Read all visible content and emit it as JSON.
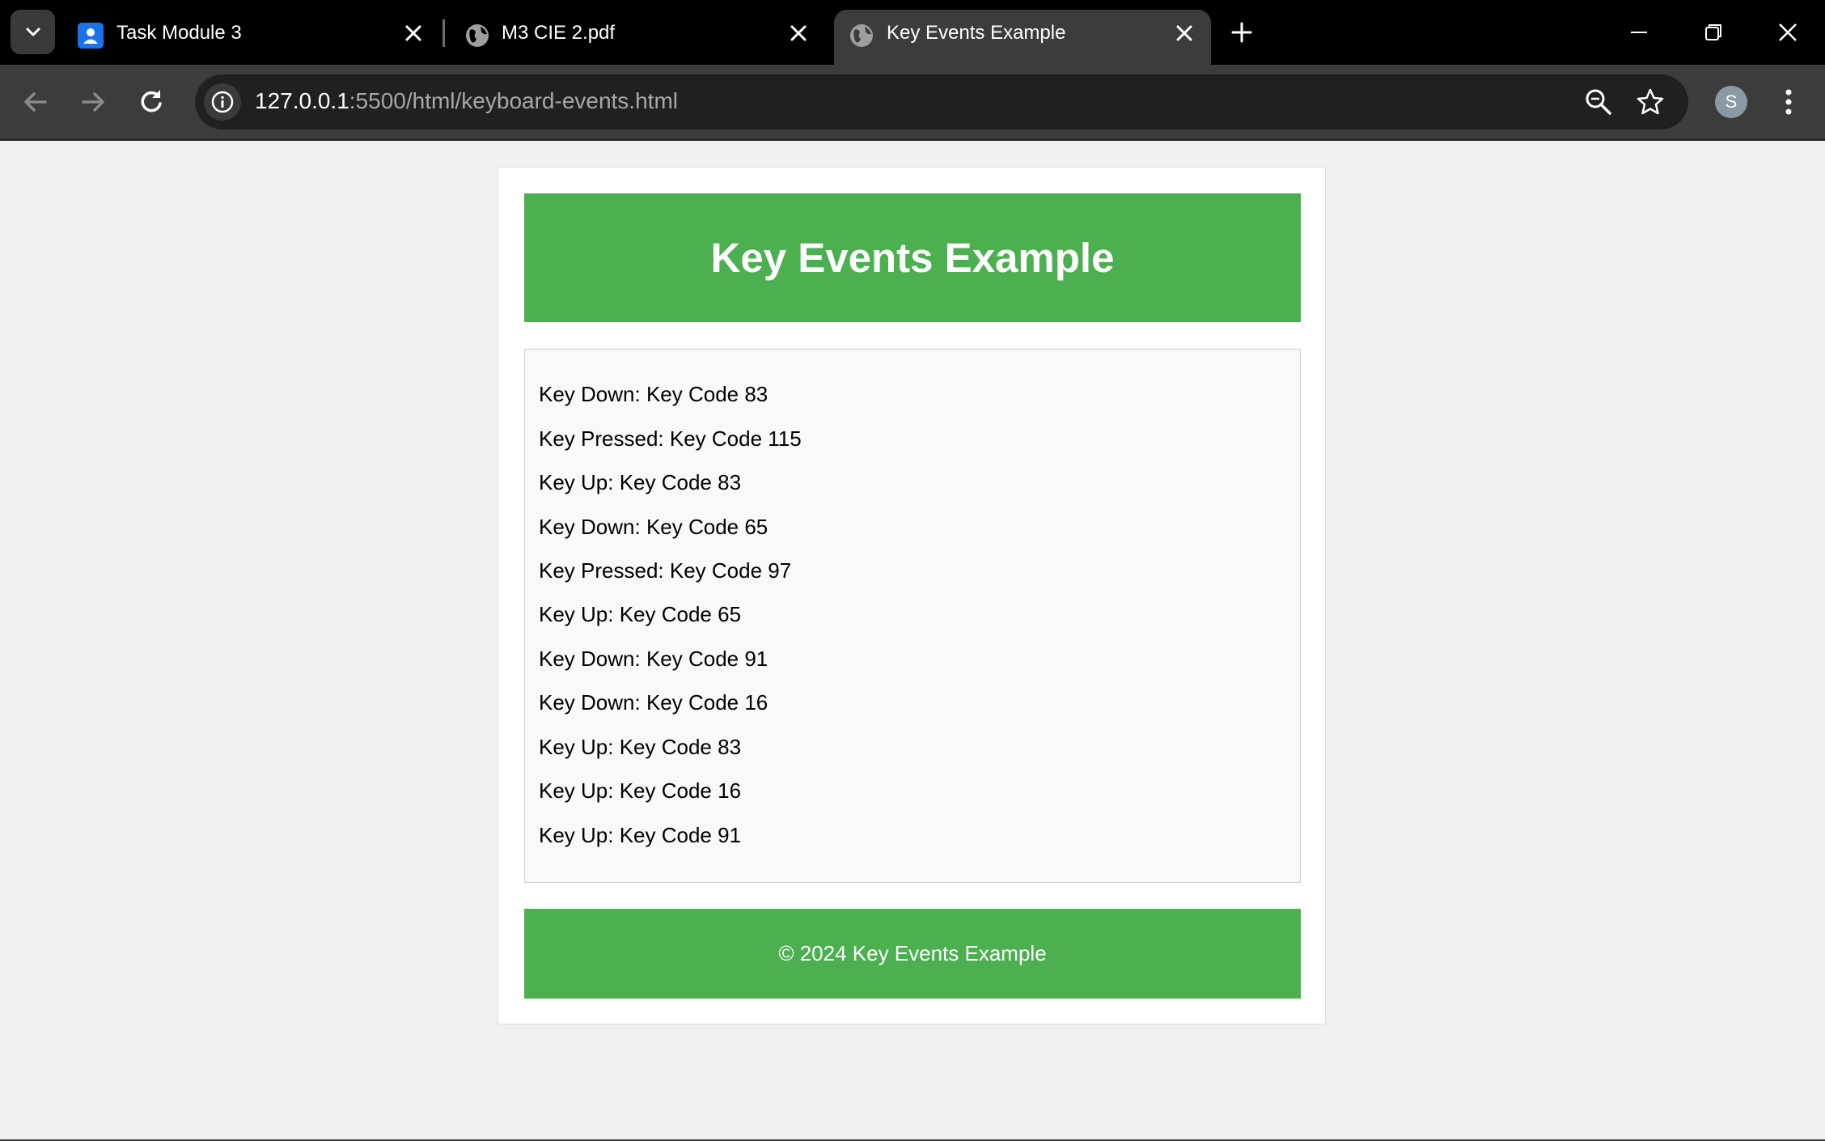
{
  "browser": {
    "tabs": [
      {
        "title": "Task Module 3",
        "active": false,
        "icon": "classroom-icon"
      },
      {
        "title": "M3 CIE 2.pdf",
        "active": false,
        "icon": "globe-icon"
      },
      {
        "title": "Key Events Example",
        "active": true,
        "icon": "globe-icon"
      }
    ],
    "url_host": "127.0.0.1",
    "url_path": ":5500/html/keyboard-events.html",
    "profile_initial": "S",
    "colors": {
      "tabstrip": "#000000",
      "toolbar": "#3c3c3c",
      "omnibox": "#202020"
    }
  },
  "page": {
    "header_title": "Key Events Example",
    "log": [
      "Key Down: Key Code 83",
      "Key Pressed: Key Code 115",
      "Key Up: Key Code 83",
      "Key Down: Key Code 65",
      "Key Pressed: Key Code 97",
      "Key Up: Key Code 65",
      "Key Down: Key Code 91",
      "Key Down: Key Code 16",
      "Key Up: Key Code 83",
      "Key Up: Key Code 16",
      "Key Up: Key Code 91"
    ],
    "footer_text": "© 2024 Key Events Example",
    "colors": {
      "accent": "#4caf50",
      "background": "#f0f0f0",
      "log_background": "#f9f9f9"
    }
  }
}
